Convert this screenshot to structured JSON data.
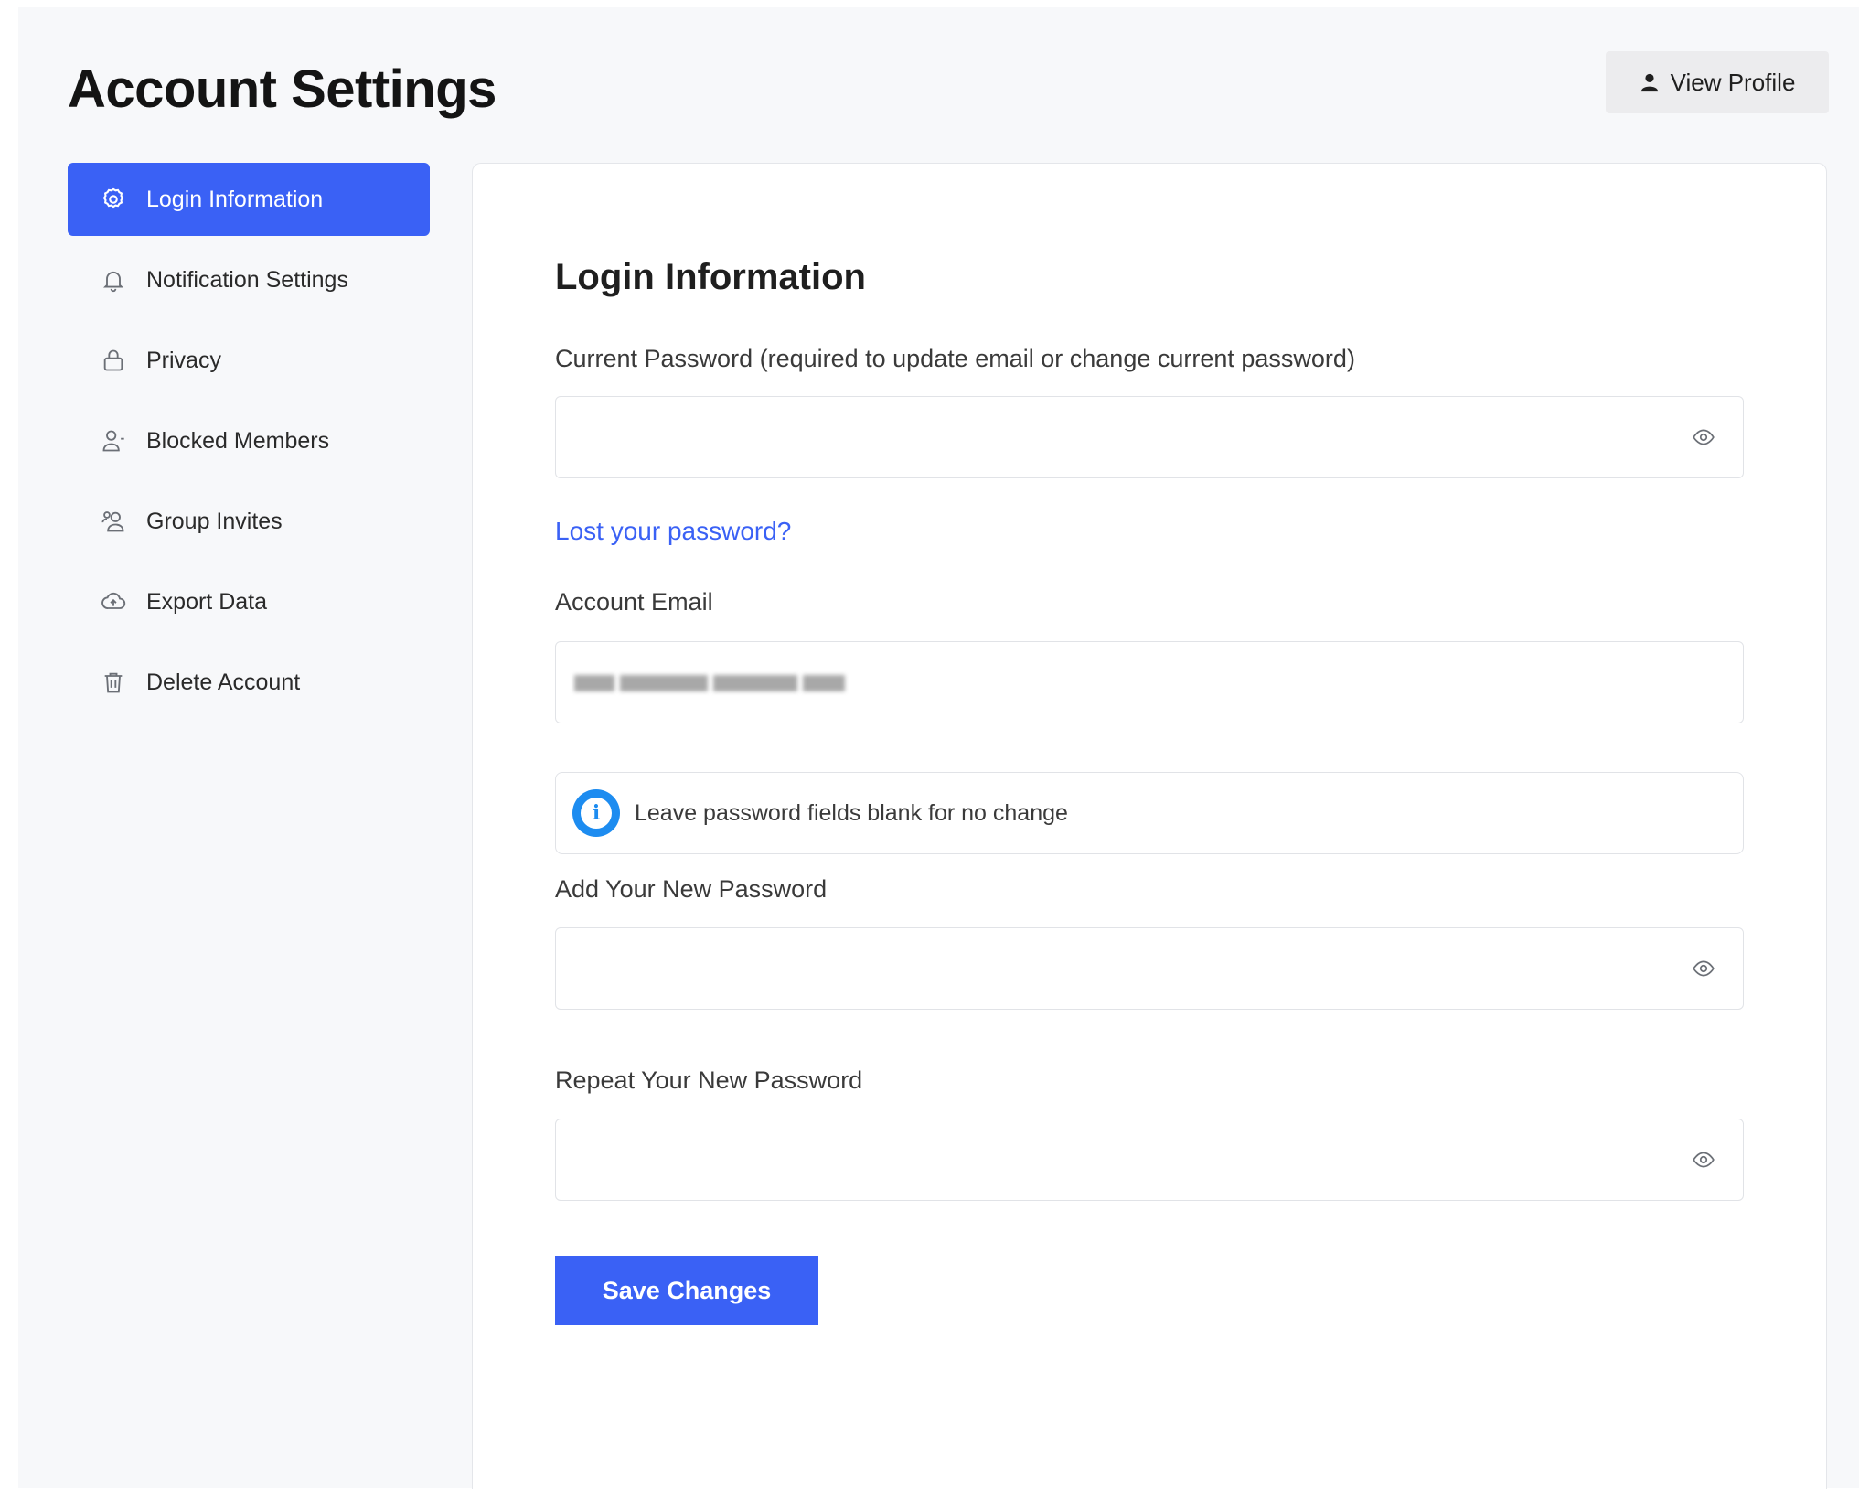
{
  "header": {
    "title": "Account Settings",
    "view_profile_label": "View Profile"
  },
  "sidebar": {
    "items": [
      {
        "label": "Login Information",
        "icon": "gear-icon",
        "active": true
      },
      {
        "label": "Notification Settings",
        "icon": "bell-icon",
        "active": false
      },
      {
        "label": "Privacy",
        "icon": "lock-icon",
        "active": false
      },
      {
        "label": "Blocked Members",
        "icon": "user-blocked-icon",
        "active": false
      },
      {
        "label": "Group Invites",
        "icon": "users-icon",
        "active": false
      },
      {
        "label": "Export Data",
        "icon": "cloud-upload-icon",
        "active": false
      },
      {
        "label": "Delete Account",
        "icon": "trash-icon",
        "active": false
      }
    ]
  },
  "main": {
    "section_title": "Login Information",
    "current_password": {
      "label": "Current Password (required to update email or change current password)",
      "value": "",
      "placeholder": ""
    },
    "lost_password_link": "Lost your password?",
    "account_email": {
      "label": "Account Email"
    },
    "info_notice": "Leave password fields blank for no change",
    "new_password": {
      "label": "Add Your New Password",
      "value": "",
      "placeholder": ""
    },
    "repeat_password": {
      "label": "Repeat Your New Password",
      "value": "",
      "placeholder": ""
    },
    "save_label": "Save Changes"
  },
  "colors": {
    "accent": "#3a61f5",
    "info": "#1d8cf0",
    "page_background": "#f7f8fa"
  }
}
